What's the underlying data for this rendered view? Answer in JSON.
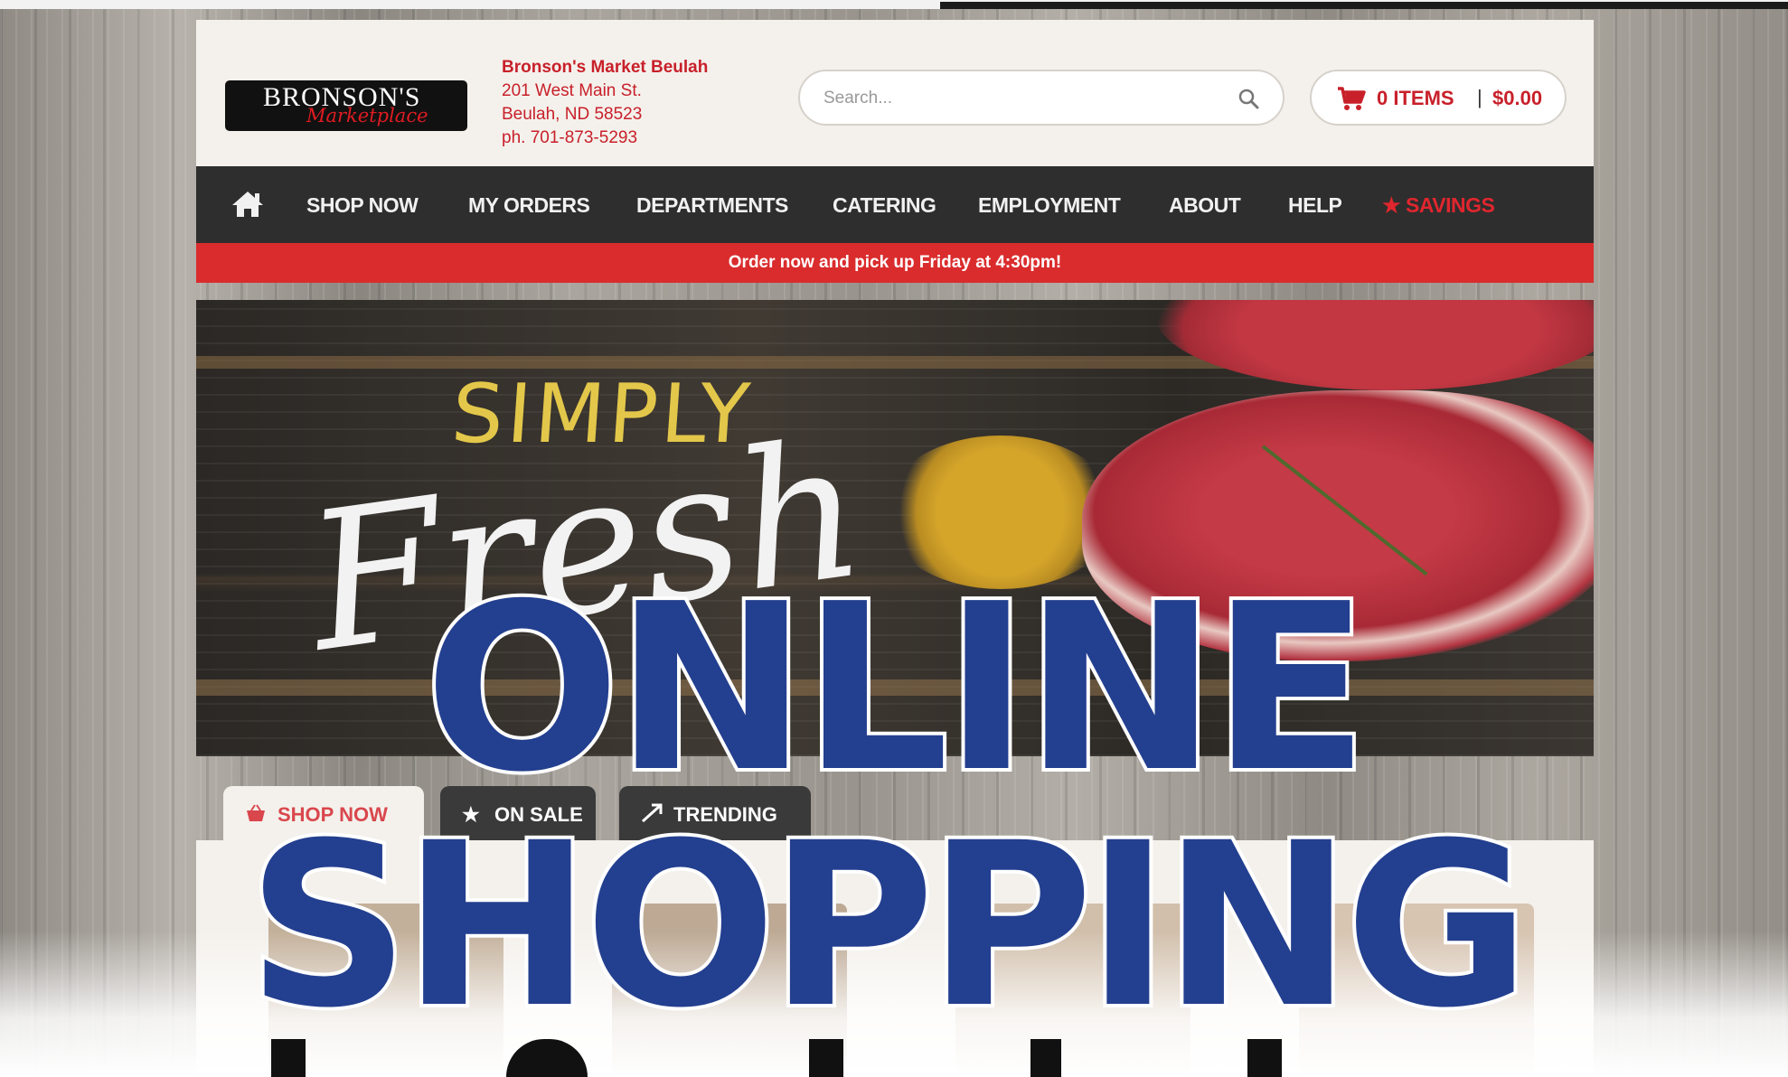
{
  "store": {
    "logo_line1": "BRONSON'S",
    "logo_line2": "Marketplace",
    "name": "Bronson's Market Beulah",
    "address": "201 West Main St.",
    "city": "Beulah, ND 58523",
    "phone": "ph. 701-873-5293"
  },
  "search": {
    "placeholder": "Search..."
  },
  "cart": {
    "items": "0 ITEMS",
    "separator": "|",
    "total": "$0.00"
  },
  "nav": {
    "items": [
      {
        "label": "SHOP NOW"
      },
      {
        "label": "MY ORDERS"
      },
      {
        "label": "DEPARTMENTS"
      },
      {
        "label": "CATERING"
      },
      {
        "label": "EMPLOYMENT"
      },
      {
        "label": "ABOUT"
      },
      {
        "label": "HELP"
      }
    ],
    "savings": "SAVINGS"
  },
  "promo": {
    "text": "Order now and pick up Friday at 4:30pm!"
  },
  "hero": {
    "line1": "SIMPLY",
    "line2": "Fresh"
  },
  "tabs": [
    {
      "label": "SHOP NOW",
      "icon": "basket-icon"
    },
    {
      "label": "ON SALE",
      "icon": "star-icon"
    },
    {
      "label": "TRENDING",
      "icon": "trending-icon"
    }
  ],
  "headline": {
    "line1": "ONLINE",
    "line2": "SHOPPING"
  },
  "colors": {
    "brand_red": "#c8202a",
    "nav_bg": "#2e2e2e",
    "promo_bg": "#da2c2d",
    "headline_blue": "#233f8f"
  }
}
